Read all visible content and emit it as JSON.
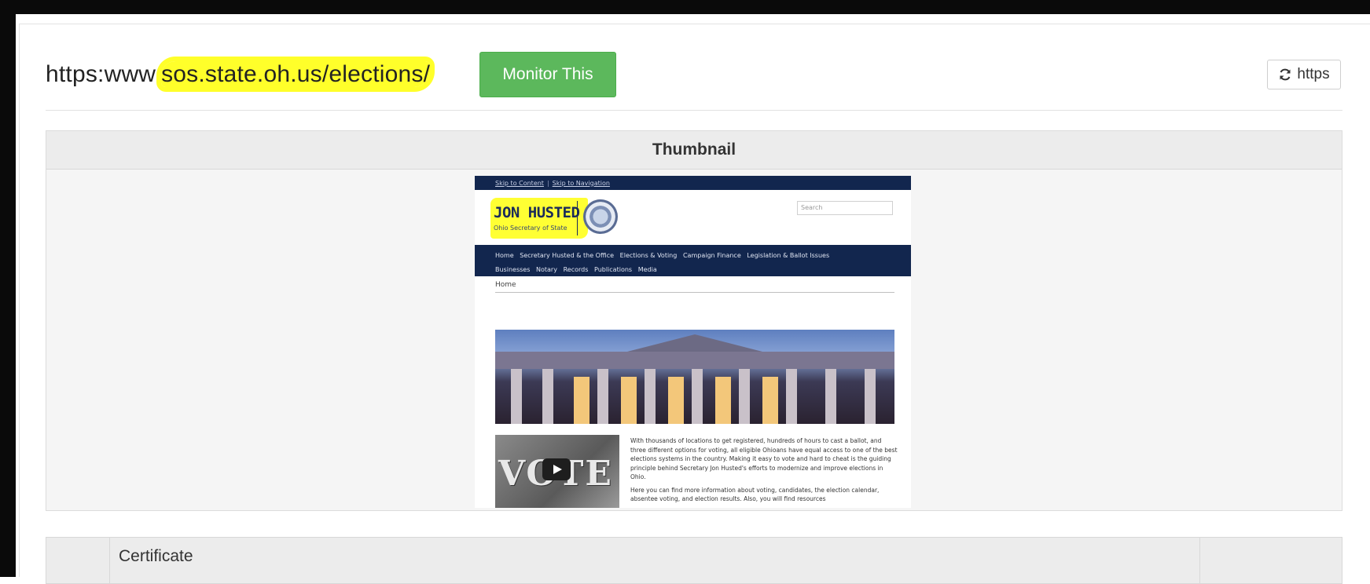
{
  "header": {
    "url_prefix": "https:www.",
    "url_highlight": "sos.state.oh.us/elections/",
    "monitor_button": "Monitor This",
    "https_button": "https"
  },
  "thumbnail_panel": {
    "title": "Thumbnail",
    "site": {
      "skip_links": [
        "Skip to Content",
        "Skip to Navigation"
      ],
      "brand_name": "JON HUSTED",
      "brand_sub": "Ohio Secretary of State",
      "search_placeholder": "Search",
      "nav_row1": "Home   Secretary Husted & the Office   Elections & Voting   Campaign Finance   Legislation & Ballot Issues",
      "nav_row2": "Businesses   Notary   Records   Publications   Media",
      "breadcrumb": "Home",
      "video_label": "VOTE",
      "paragraph1": "With thousands of locations to get registered, hundreds of hours to cast a ballot, and three different options for voting, all eligible Ohioans have equal access to one of the best elections systems in the country. Making it easy to vote and hard to cheat is the guiding principle behind Secretary Jon Husted's efforts to modernize and improve elections in Ohio.",
      "paragraph2": "Here you can find more information about voting, candidates, the election calendar, absentee voting, and election results. Also, you will find resources"
    }
  },
  "certificate_panel": {
    "title": "Certificate"
  },
  "colors": {
    "monitor_green": "#5cb85c",
    "highlight_yellow": "#ffff2a",
    "site_navy": "#12264e"
  },
  "icons": {
    "refresh": "refresh-icon",
    "play": "play-icon"
  }
}
